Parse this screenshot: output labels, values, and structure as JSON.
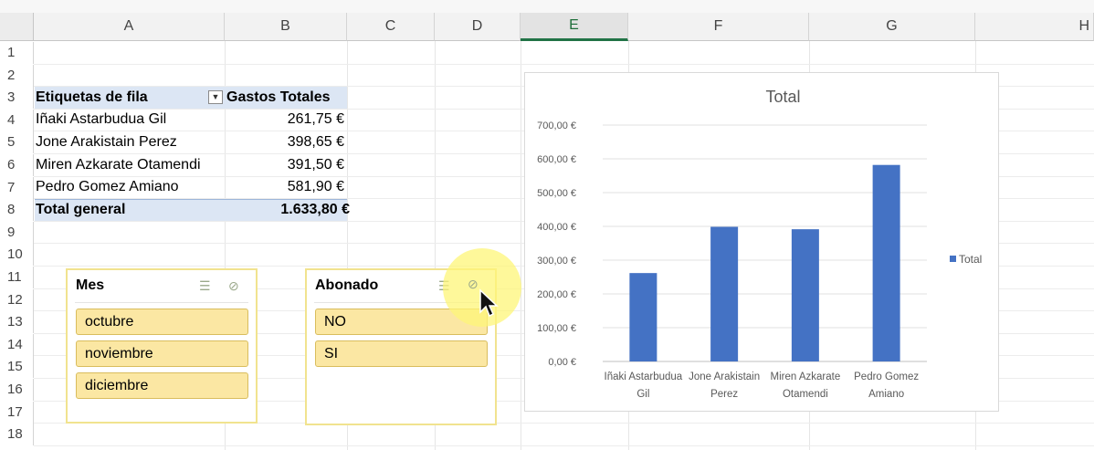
{
  "columns": [
    "A",
    "B",
    "C",
    "D",
    "E",
    "F",
    "G",
    "H"
  ],
  "rows": [
    "1",
    "2",
    "3",
    "4",
    "5",
    "6",
    "7",
    "8",
    "9",
    "10",
    "11",
    "12",
    "13",
    "14",
    "15",
    "16",
    "17",
    "18"
  ],
  "selected_column": "E",
  "pivot": {
    "header_label": "Etiquetas de fila",
    "header_value": "Gastos Totales",
    "rows": [
      {
        "name": "Iñaki Astarbudua Gil",
        "value": "261,75 €"
      },
      {
        "name": "Jone Arakistain Perez",
        "value": "398,65 €"
      },
      {
        "name": "Miren Azkarate Otamendi",
        "value": "391,50 €"
      },
      {
        "name": "Pedro Gomez Amiano",
        "value": "581,90 €"
      }
    ],
    "total_label": "Total general",
    "total_value": "1.633,80 €"
  },
  "slicers": [
    {
      "title": "Mes",
      "items": [
        "octubre",
        "noviembre",
        "diciembre"
      ]
    },
    {
      "title": "Abonado",
      "items": [
        "NO",
        "SI"
      ]
    }
  ],
  "chart_data": {
    "type": "bar",
    "title": "Total",
    "categories": [
      "Iñaki Astarbudua Gil",
      "Jone Arakistain Perez",
      "Miren Azkarate Otamendi",
      "Pedro Gomez Amiano"
    ],
    "category_lines": [
      [
        "Iñaki Astarbudua",
        "Gil"
      ],
      [
        "Jone Arakistain",
        "Perez"
      ],
      [
        "Miren Azkarate",
        "Otamendi"
      ],
      [
        "Pedro Gomez",
        "Amiano"
      ]
    ],
    "series": [
      {
        "name": "Total",
        "values": [
          261.75,
          398.65,
          391.5,
          581.9
        ]
      }
    ],
    "ylim": [
      0,
      700
    ],
    "yticks": [
      0,
      100,
      200,
      300,
      400,
      500,
      600,
      700
    ],
    "ytick_labels": [
      "0,00 €",
      "100,00 €",
      "200,00 €",
      "300,00 €",
      "400,00 €",
      "500,00 €",
      "600,00 €",
      "700,00 €"
    ],
    "legend": "right",
    "grid": true,
    "bar_color": "#4472c4"
  },
  "colors": {
    "accent": "#217346",
    "pivot_header": "#dce6f4",
    "slicer_item": "#fbe7a3",
    "slicer_border": "#f1e38f"
  }
}
